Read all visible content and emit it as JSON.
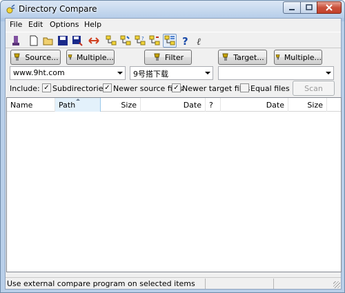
{
  "window": {
    "title": "Directory Compare"
  },
  "menu": [
    "File",
    "Edit",
    "Options",
    "Help"
  ],
  "toolbar": [
    {
      "name": "compare-icon"
    },
    {
      "name": "new-icon"
    },
    {
      "name": "open-icon"
    },
    {
      "name": "save-icon"
    },
    {
      "name": "save-as-icon"
    },
    {
      "name": "swap-icon"
    },
    {
      "name": "tree-view-icon"
    },
    {
      "name": "expand-tree-icon"
    },
    {
      "name": "collapse-tree-icon"
    },
    {
      "name": "mark-tree-icon"
    },
    {
      "name": "show-all-icon"
    },
    {
      "name": "help-icon"
    },
    {
      "name": "context-help-icon"
    }
  ],
  "buttons": {
    "source": "Source...",
    "source_multiple": "Multiple...",
    "filter": "Filter",
    "target": "Target...",
    "target_multiple": "Multiple...",
    "scan": "Scan"
  },
  "combos": {
    "source_path": "www.9ht.com",
    "filter_value": "9号搭下载",
    "target_path": ""
  },
  "include": {
    "label": "Include:",
    "options": [
      {
        "label": "Subdirectories",
        "checked": true
      },
      {
        "label": "Newer source files",
        "checked": true
      },
      {
        "label": "Newer target files",
        "checked": true
      },
      {
        "label": "Equal files",
        "checked": false
      }
    ]
  },
  "columns": [
    "Name",
    "Path",
    "Size",
    "Date",
    "?",
    "Date",
    "Size"
  ],
  "rows": [],
  "status": {
    "text": "Use external compare program on selected items"
  },
  "colors": {
    "accent": "#3399ff",
    "button_icon": "#c8a400"
  }
}
